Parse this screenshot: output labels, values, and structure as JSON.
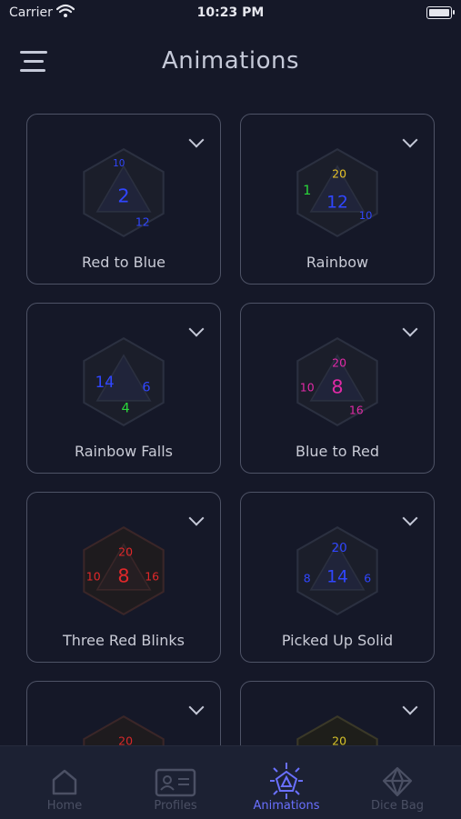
{
  "status": {
    "carrier": "Carrier",
    "time": "10:23 PM"
  },
  "header": {
    "title": "Animations"
  },
  "animations": [
    {
      "label": "Red to Blue",
      "colors": [
        "#2a3bd6",
        "#3046ff"
      ]
    },
    {
      "label": "Rainbow",
      "colors": [
        "#2ad63a",
        "#e6c227",
        "#3046ff"
      ]
    },
    {
      "label": "Rainbow Falls",
      "colors": [
        "#3046ff",
        "#2ad63a"
      ]
    },
    {
      "label": "Blue to Red",
      "colors": [
        "#e02aa6",
        "#c01f8f"
      ]
    },
    {
      "label": "Three Red Blinks",
      "colors": [
        "#e0282a",
        "#b81f22"
      ]
    },
    {
      "label": "Picked Up Solid",
      "colors": [
        "#2a3bd6",
        "#3046ff"
      ]
    },
    {
      "label": "",
      "colors": [
        "#d6282a"
      ]
    },
    {
      "label": "",
      "colors": [
        "#d6c22a"
      ]
    }
  ],
  "nav": {
    "home": "Home",
    "profiles": "Profiles",
    "animations": "Animations",
    "dice_bag": "Dice Bag"
  }
}
